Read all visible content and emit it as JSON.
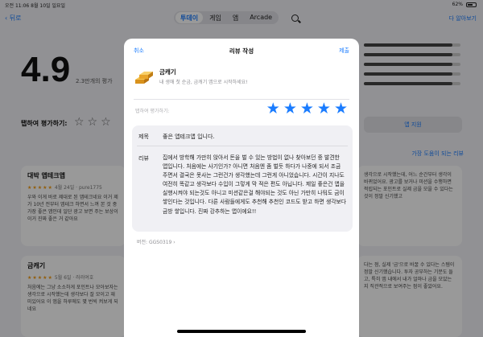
{
  "status": {
    "time_date": "오전 11:06   8월 10일 일요일",
    "battery": "62%"
  },
  "nav": {
    "back_label": "뒤로",
    "tabs": [
      "투데이",
      "게임",
      "앱",
      "Arcade"
    ],
    "active_tab": "투데이",
    "feedback_label": "다 알아보기"
  },
  "ratings": {
    "score": "4.9",
    "count_label": "2.3만개의 평가",
    "tap_to_rate_label": "탭하여 평가하기:",
    "tap_stars": "☆☆☆",
    "support_label": "앱 지원",
    "sort_label": "가장 도움이 되는 리뷰"
  },
  "bg_reviews": [
    {
      "title": "대박 앱테크앱",
      "stars": "★★★★★",
      "meta": "4월 24일 · pure1775",
      "body": "우와 이게 바로 제대로 된 앱테크네요 이거 제가 10년 전부터 앱테크 하면서 느껴 본 것 중 가장 좋은 앱인데 일단 광고 보면 주는 보상이 이거 진짜 좋은 거 같아요"
    },
    {
      "title": "금캐기",
      "stars": "★★★★★",
      "meta": "5월 6일 · 러러여호",
      "body": "처음에는 그냥 소소하게 포인트나 모아보자는 생각으로 시작했는데 생각보다 잘 모이고 재미있어요 이 앱을 하루에도 몇 번씩 켜보게 되네요"
    },
    {
      "title": "",
      "stars": "",
      "meta": "",
      "body": "생각으로 시작했는데, 어느 순간부터 생각이 바뀌었어요. 광고를 보거나 미션을 수행하면 적립되는 포인트로 실제 금을 모을 수 있다는 것이 정말 신기했고"
    },
    {
      "title": "",
      "stars": "",
      "meta": "",
      "body": "다는 점, 실제 '금'으로 바꿀 수 있다는 스템이 정말 신기했습니다. 투자 공부하는 기분도 들고, 특히 앱 내에서 내가 얼마나 금을 모았는지 직관적으로 보여주는 점이 좋았어요."
    }
  ],
  "modal": {
    "cancel_label": "취소",
    "title": "리뷰 작성",
    "submit_label": "제출",
    "app_name": "금캐기",
    "app_subtitle": "내 생애 첫 순금, 금캐기 앱으로 시작하세요!",
    "tap_to_rate_label": "탭하여 평가하기:",
    "rating_value": 5,
    "rating_max": 5,
    "title_label": "제목",
    "title_value": "좋은 앱테크앱 입니다.",
    "review_label": "리뷰",
    "review_body": "집에서 방학해 가만히 앉아서 돈을 벌 수 있는 방법이 없나 찾아보던 중 발견한 앱입니다. 처음에는 사기인가? 아니면 처음엔 좀 벌듯 하다가 나중에 되서 조금 주면서 결국은 못사는 그런건가 생각했는데 그런게 아니었습니다. 시간이 지나도 여전히 똑같고 생각보다 수입이 그렇게 막 적은 편도 아닙니다. 제일 좋은건 앱을 실행시켜야 되는것도 아니고 미션같은걸 해야되는 것도 아닌 가만히 나둬도 금이 쌓인다는 것입니다. 다른 사람들에게도 추천해 추천인 코드도 받고 하면 생각보다 금방 쌓입니다. 진짜 강추하는 앱이에요!!",
    "version_label": "버전: GGS0319"
  },
  "colors": {
    "accent": "#1a7cff",
    "background": "#f2f2f7",
    "gold": "#e9a52a"
  }
}
